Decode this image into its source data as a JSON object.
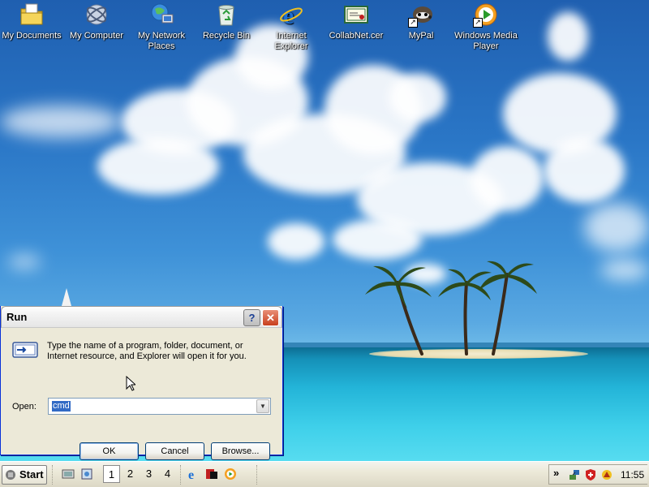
{
  "desktop": {
    "icons": [
      {
        "label": "My Documents",
        "icon": "my-documents-icon"
      },
      {
        "label": "My Computer",
        "icon": "my-computer-icon"
      },
      {
        "label": "My Network Places",
        "icon": "my-network-places-icon"
      },
      {
        "label": "Recycle Bin",
        "icon": "recycle-bin-icon"
      },
      {
        "label": "Internet Explorer",
        "icon": "internet-explorer-icon"
      },
      {
        "label": "CollabNet.cer",
        "icon": "certificate-icon"
      },
      {
        "label": "MyPal",
        "icon": "mypal-icon"
      },
      {
        "label": "Windows Media Player",
        "icon": "windows-media-player-icon"
      }
    ]
  },
  "run_dialog": {
    "title": "Run",
    "help_label": "?",
    "close_label": "✕",
    "description": "Type the name of a program, folder, document, or Internet resource, and Explorer will open it for you.",
    "open_label": "Open:",
    "open_value": "cmd",
    "ok_label": "OK",
    "cancel_label": "Cancel",
    "browse_label": "Browse..."
  },
  "taskbar": {
    "start_label": "Start",
    "workspaces": [
      "1",
      "2",
      "3",
      "4"
    ],
    "active_workspace": "1",
    "tray_expand": "»",
    "clock": "11:55"
  },
  "colors": {
    "title_text": "#000000",
    "close_button": "#c8401e",
    "selection": "#316ac5",
    "taskbar": "#ece9d8"
  }
}
